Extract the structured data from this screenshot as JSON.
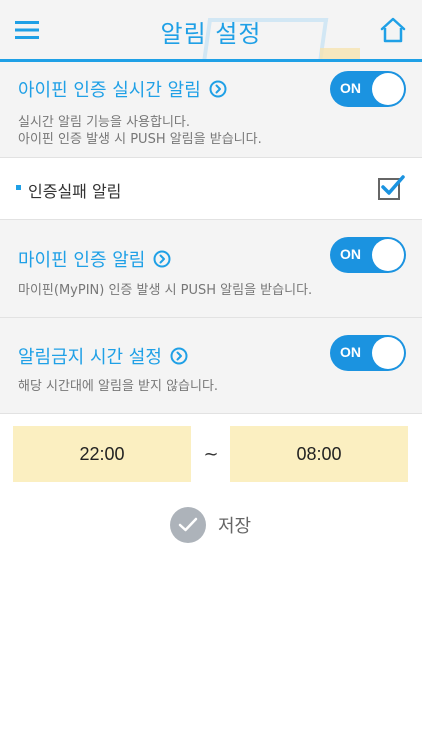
{
  "header": {
    "title": "알림 설정",
    "menu_icon": "hamburger-icon",
    "home_icon": "home-icon"
  },
  "sections": {
    "ipin_realtime": {
      "title": "아이핀 인증 실시간 알림",
      "toggle_label": "ON",
      "desc_line1": "실시간 알림 기능을 사용합니다.",
      "desc_line2": "아이핀 인증 발생 시 PUSH 알림을 받습니다."
    },
    "auth_fail": {
      "label": "인증실패 알림",
      "checked": true
    },
    "mypin": {
      "title": "마이핀 인증 알림",
      "toggle_label": "ON",
      "desc": "마이핀(MyPIN) 인증 발생 시 PUSH 알림을 받습니다."
    },
    "quiet_time": {
      "title": "알림금지 시간 설정",
      "toggle_label": "ON",
      "desc": "해당 시간대에 알림을 받지 않습니다."
    }
  },
  "time_range": {
    "start": "22:00",
    "separator": "~",
    "end": "08:00"
  },
  "save": {
    "label": "저장",
    "icon": "checkmark-icon"
  },
  "colors": {
    "accent": "#1fa0e6",
    "toggle_on": "#1b93e0",
    "time_box": "#fbefc1",
    "save_icon_bg": "#adb3ba"
  }
}
